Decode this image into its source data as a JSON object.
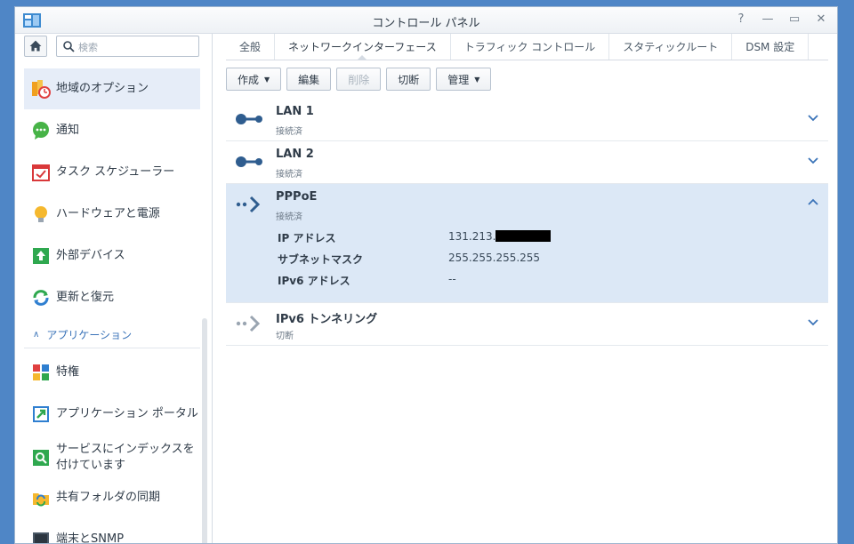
{
  "window": {
    "title": "コントロール パネル"
  },
  "sidebar": {
    "search_placeholder": "検索",
    "items": [
      {
        "label": "地域のオプション",
        "icon": "region-options-icon"
      },
      {
        "label": "通知",
        "icon": "notification-icon"
      },
      {
        "label": "タスク スケジューラー",
        "icon": "task-scheduler-icon"
      },
      {
        "label": "ハードウェアと電源",
        "icon": "hardware-power-icon"
      },
      {
        "label": "外部デバイス",
        "icon": "external-devices-icon"
      },
      {
        "label": "更新と復元",
        "icon": "update-restore-icon"
      }
    ],
    "section_label": "アプリケーション",
    "app_items": [
      {
        "label": "特権",
        "icon": "privileges-icon"
      },
      {
        "label": "アプリケーション ポータル",
        "icon": "application-portal-icon"
      },
      {
        "label": "サービスにインデックスを付けています",
        "label_line1": "サービスにインデックスを",
        "label_line2": "付けています",
        "icon": "indexing-service-icon"
      },
      {
        "label": "共有フォルダの同期",
        "icon": "shared-folder-sync-icon"
      },
      {
        "label": "端末とSNMP",
        "icon": "terminal-snmp-icon"
      }
    ]
  },
  "tabs": [
    "全般",
    "ネットワークインターフェース",
    "トラフィック コントロール",
    "スタティックルート",
    "DSM 設定"
  ],
  "toolbar": {
    "create": "作成",
    "edit": "編集",
    "delete": "削除",
    "disconnect": "切断",
    "manage": "管理"
  },
  "interfaces": [
    {
      "name": "LAN 1",
      "status": "接続済"
    },
    {
      "name": "LAN 2",
      "status": "接続済"
    },
    {
      "name": "PPPoE",
      "status": "接続済",
      "details": [
        {
          "label": "IP アドレス",
          "value": "131.213."
        },
        {
          "label": "サブネットマスク",
          "value": "255.255.255.255"
        },
        {
          "label": "IPv6 アドレス",
          "value": "--"
        }
      ]
    },
    {
      "name": "IPv6 トンネリング",
      "status": "切断"
    }
  ],
  "colors": {
    "accent": "#3a73b8",
    "selected_row": "#dce8f6",
    "icon_dark": "#2f5d8f"
  }
}
